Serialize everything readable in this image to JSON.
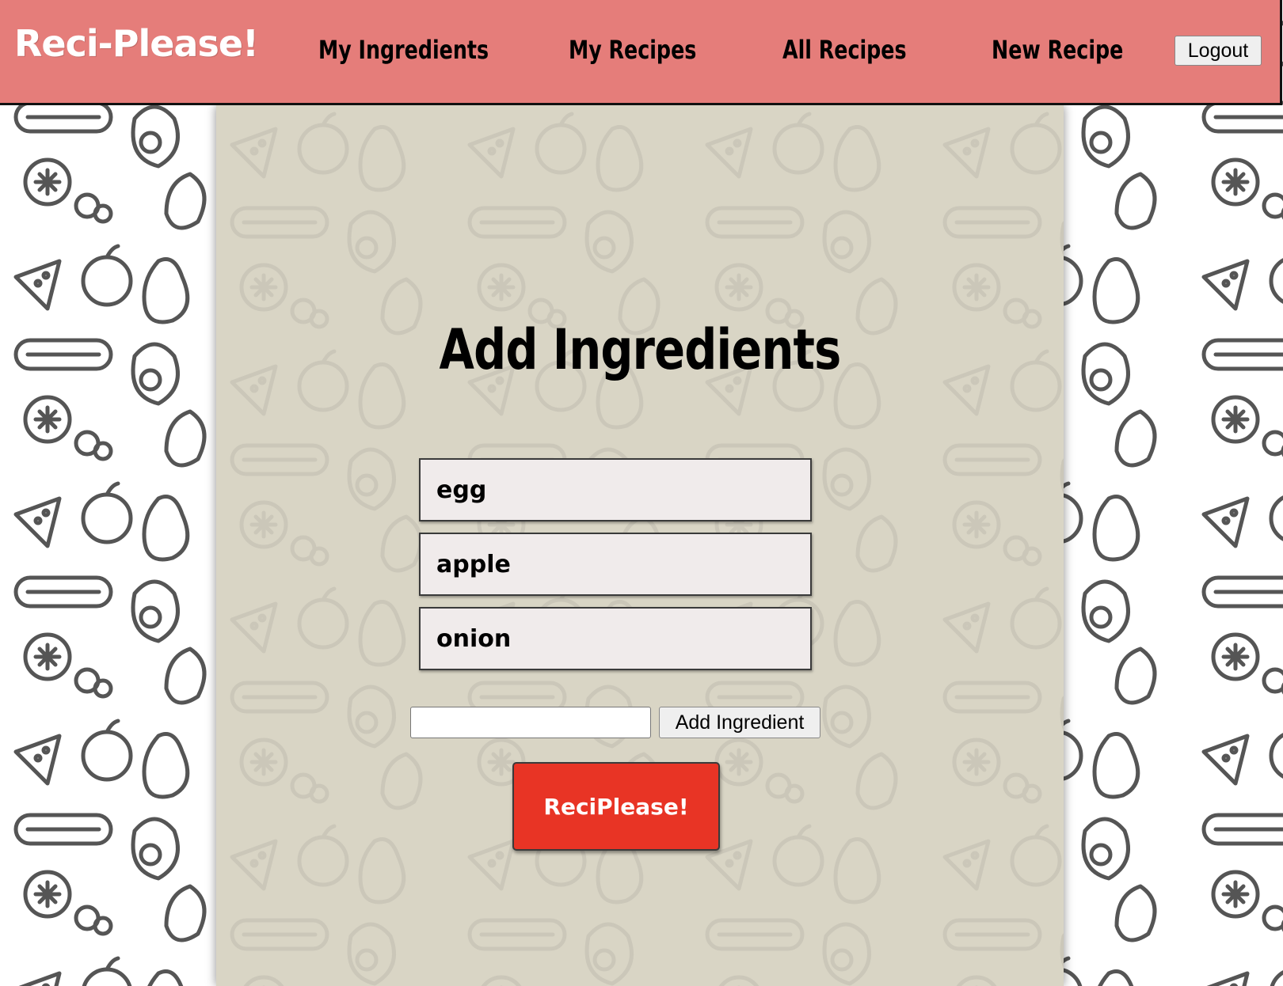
{
  "colors": {
    "navbar": "#e57d7a",
    "panel": "#d9d5c5",
    "submit_button": "#e83425",
    "ingredient_card": "#f0ebeb"
  },
  "header": {
    "logo": "Reci-Please!",
    "nav": [
      {
        "label": "My Ingredients"
      },
      {
        "label": "My Recipes"
      },
      {
        "label": "All Recipes"
      },
      {
        "label": "New Recipe"
      }
    ],
    "logout_label": "Logout"
  },
  "main": {
    "title": "Add Ingredients",
    "ingredients": [
      "egg",
      "apple",
      "onion"
    ],
    "new_ingredient_value": "",
    "add_button_label": "Add Ingredient",
    "submit_label": "ReciPlease!"
  },
  "background": {
    "pattern": "fruit-and-vegetable-line-icons"
  }
}
